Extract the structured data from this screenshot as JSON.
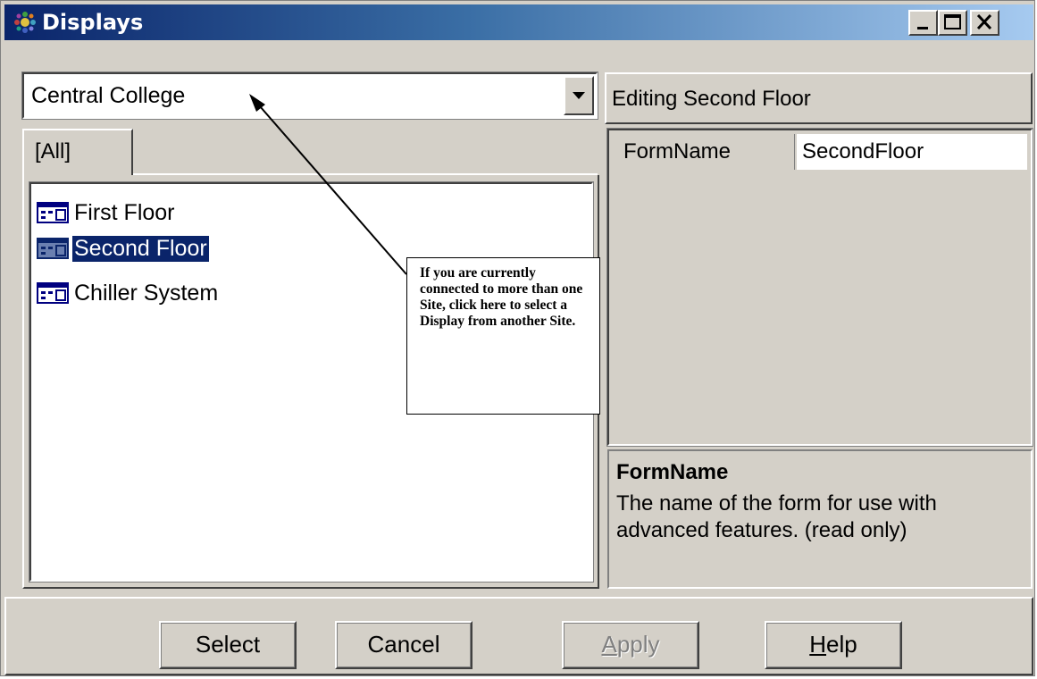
{
  "window": {
    "title": "Displays",
    "controls": [
      "minimize",
      "maximize",
      "close"
    ]
  },
  "site_selector": {
    "value": "Central College"
  },
  "tabs": [
    {
      "label": "[All]"
    }
  ],
  "displays_list": [
    {
      "label": "First Floor",
      "icon": "display-icon",
      "selected": false
    },
    {
      "label": "Second Floor",
      "icon": "display-icon",
      "selected": true
    },
    {
      "label": "Chiller System",
      "icon": "display-icon",
      "selected": false
    }
  ],
  "editor": {
    "header": "Editing Second Floor",
    "properties": [
      {
        "name": "FormName",
        "value": "SecondFloor"
      }
    ],
    "description": {
      "title": "FormName",
      "text": "The name of the form for use with advanced features. (read only)"
    }
  },
  "buttons": {
    "select": "Select",
    "cancel": "Cancel",
    "apply": "Apply",
    "help": "Help"
  },
  "annotation": {
    "text": "If you are currently connected to more than one Site, click here to select a Display from another Site."
  },
  "colors": {
    "titlebar_start": "#0a246a",
    "titlebar_end": "#a6caf0",
    "selection": "#0a246a",
    "face": "#d4d0c8"
  }
}
